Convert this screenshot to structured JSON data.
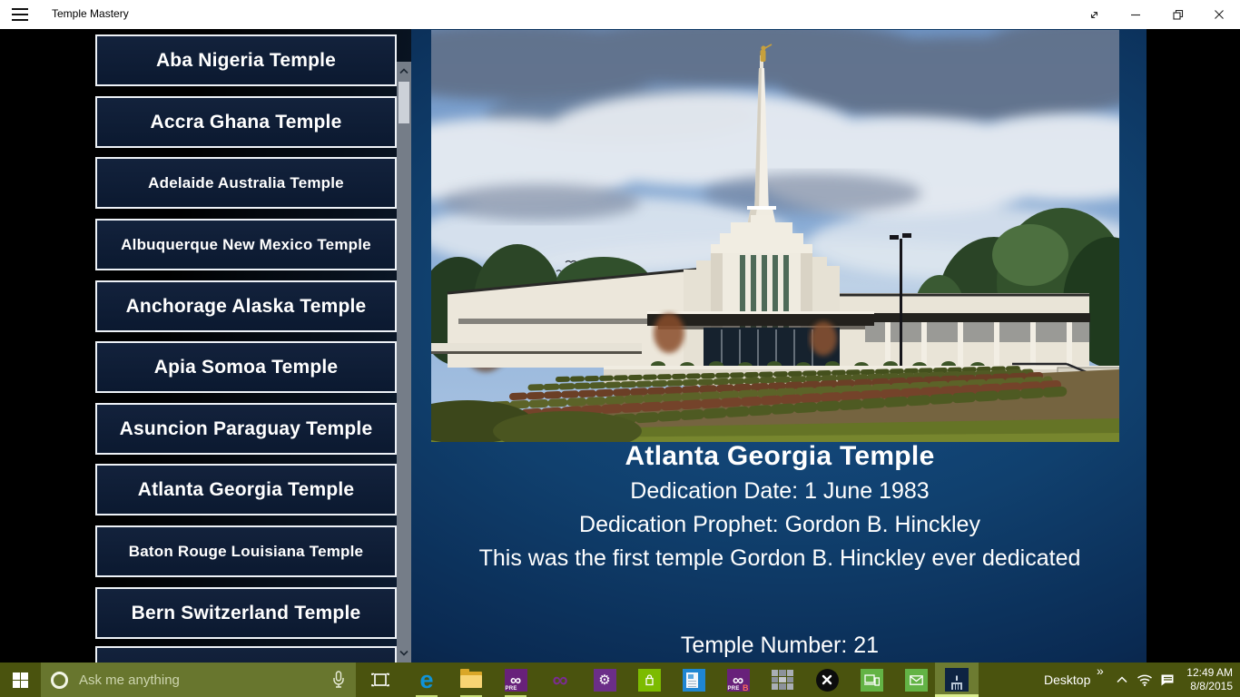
{
  "titlebar": {
    "title": "Temple Mastery",
    "controls": [
      "hamburger-icon",
      "fullscreen-icon",
      "minimize-icon",
      "restore-icon",
      "close-icon"
    ]
  },
  "sidebar": {
    "temples": [
      "Aba Nigeria Temple",
      "Accra Ghana Temple",
      "Adelaide Australia Temple",
      "Albuquerque New Mexico Temple",
      "Anchorage Alaska Temple",
      "Apia Somoa Temple",
      "Asuncion Paraguay Temple",
      "Atlanta Georgia Temple",
      "Baton Rouge Louisiana Temple",
      "Bern Switzerland Temple"
    ],
    "scrollbar": [
      "scroll-up-icon",
      "scroll-thumb",
      "scroll-down-icon"
    ]
  },
  "detail": {
    "title": "Atlanta Georgia Temple",
    "dedication_date": "Dedication Date: 1 June 1983",
    "dedication_prophet": "Dedication Prophet: Gordon B. Hinckley",
    "fact": "This was the first temple Gordon B. Hinckley ever dedicated",
    "temple_number": "Temple Number: 21",
    "photo_subject": "Atlanta Georgia Temple exterior, white modern temple with single gold-angel spire, cloudy sky, terraced shrub rows and lawn"
  },
  "taskbar": {
    "search_placeholder": "Ask me anything",
    "vs_pre_badge": "PRE",
    "vs_preb_badge": "PRE",
    "vs_preb_letter": "B",
    "desktop_label": "Desktop",
    "overflow_chevron": "»",
    "time": "12:49 AM",
    "date": "8/8/2015",
    "icons": [
      "start-icon",
      "cortana-circle-icon",
      "microphone-icon",
      "task-view-icon",
      "edge-icon",
      "file-explorer-icon",
      "visual-studio-pre-icon",
      "visual-studio-icon",
      "settings-gear-icon",
      "store-icon",
      "news-icon",
      "visual-studio-pre-b-icon",
      "gray-blocks-icon",
      "xbox-icon",
      "phone-companion-icon",
      "mail-icon",
      "temple-mastery-app-icon",
      "desktop-toolbar",
      "hidden-icons-chevron",
      "wifi-icon",
      "action-center-icon",
      "clock"
    ]
  },
  "colors": {
    "taskbar": "#4a530e",
    "search_box": "#68762e",
    "active_slot": "#6d7b31",
    "running_indicator": "#c7dc78",
    "button_navy": "#0e1c33",
    "detail_blue": "#175089",
    "vs_purple": "#68217a",
    "store_green": "#7cbb00"
  }
}
